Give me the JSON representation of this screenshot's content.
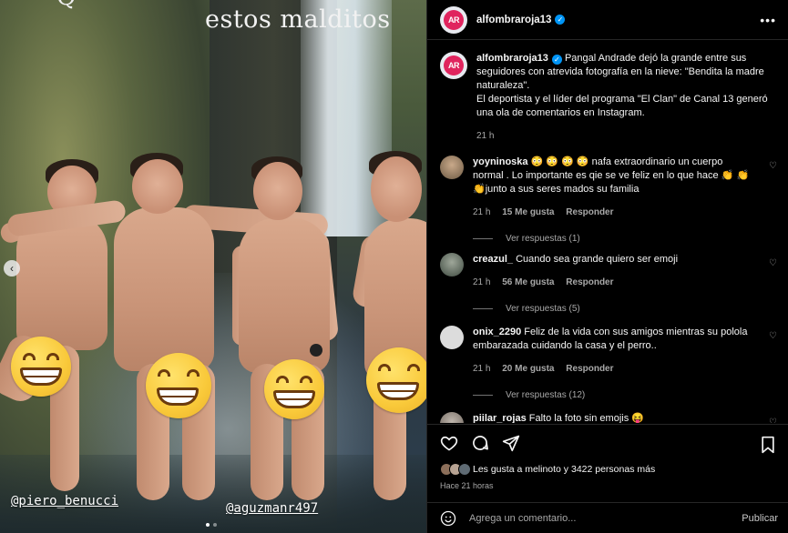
{
  "photo": {
    "overlay_text": "estos malditos",
    "partial_char": "Q",
    "tag_left": "@piero_benucci",
    "tag_right": "@aguzmanr497"
  },
  "header": {
    "username": "alfombraroja13",
    "logo_text": "AR"
  },
  "caption": {
    "username": "alfombraroja13",
    "text_1": "Pangal Andrade dejó la grande entre sus seguidores con atrevida fotografía en la nieve: \"Bendita la madre naturaleza\".",
    "text_2": "El deportista y el líder del programa \"El Clan\" de Canal 13 generó una ola de comentarios en Instagram.",
    "time": "21 h"
  },
  "comments": [
    {
      "username": "yoyninoska",
      "text": "😳 😳 😳 😳 nafa extraordinario un cuerpo normal . Lo importante es qie se ve feliz en lo que hace 👏 👏 👏junto a sus seres mados su familia",
      "time": "21 h",
      "likes": "15 Me gusta",
      "reply": "Responder",
      "view_replies": "Ver respuestas (1)"
    },
    {
      "username": "creazul_",
      "text": "Cuando sea grande quiero ser emoji",
      "time": "21 h",
      "likes": "56 Me gusta",
      "reply": "Responder",
      "view_replies": "Ver respuestas (5)"
    },
    {
      "username": "onix_2290",
      "text": "Feliz de la vida con sus amigos mientras su polola embarazada cuidando la casa y el perro..",
      "time": "21 h",
      "likes": "20 Me gusta",
      "reply": "Responder",
      "view_replies": "Ver respuestas (12)"
    },
    {
      "username": "piilar_rojas",
      "text": "Falto la foto sin emojis 😝"
    }
  ],
  "likes_text": "Les gusta a melinoto y 3422 personas más",
  "posted": "Hace 21 horas",
  "add_comment": {
    "placeholder": "Agrega un comentario...",
    "publish": "Publicar"
  }
}
